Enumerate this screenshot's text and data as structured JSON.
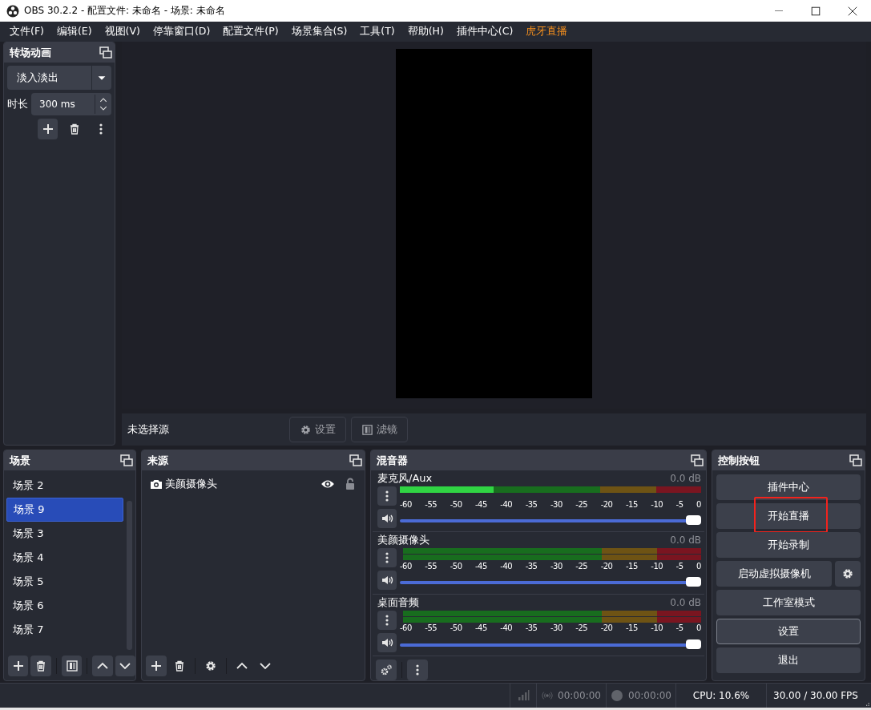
{
  "window": {
    "title": "OBS 30.2.2 - 配置文件: 未命名 - 场景: 未命名"
  },
  "menu": [
    {
      "label": "文件(F)",
      "accent": false
    },
    {
      "label": "编辑(E)",
      "accent": false
    },
    {
      "label": "视图(V)",
      "accent": false
    },
    {
      "label": "停靠窗口(D)",
      "accent": false
    },
    {
      "label": "配置文件(P)",
      "accent": false
    },
    {
      "label": "场景集合(S)",
      "accent": false
    },
    {
      "label": "工具(T)",
      "accent": false
    },
    {
      "label": "帮助(H)",
      "accent": false
    },
    {
      "label": "插件中心(C)",
      "accent": false
    },
    {
      "label": "虎牙直播",
      "accent": true
    }
  ],
  "transitions": {
    "title": "转场动画",
    "selected_transition": "淡入淡出",
    "duration_label": "时长",
    "duration": "300 ms"
  },
  "preview": {
    "source_status": "未选择源",
    "buttons": [
      {
        "label": "设置",
        "kind": "properties",
        "disabled": true
      },
      {
        "label": "滤镜",
        "kind": "filters",
        "disabled": true
      }
    ]
  },
  "scenes": {
    "title": "场景",
    "items": [
      {
        "label": "场景 2",
        "selected": false
      },
      {
        "label": "场景 9",
        "selected": true
      },
      {
        "label": "场景 3",
        "selected": false
      },
      {
        "label": "场景 4",
        "selected": false
      },
      {
        "label": "场景 5",
        "selected": false
      },
      {
        "label": "场景 6",
        "selected": false
      },
      {
        "label": "场景 7",
        "selected": false
      }
    ]
  },
  "sources": {
    "title": "来源",
    "items": [
      {
        "label": "美颜摄像头",
        "kind": "camera",
        "visible": true,
        "locked": false
      }
    ]
  },
  "mixer": {
    "title": "混音器",
    "channels": [
      {
        "name": "麦克风/Aux",
        "reading": "0.0 dB",
        "meter": {
          "kind": "mono",
          "level": 0.31
        },
        "scale": [
          "-60",
          "-55",
          "-50",
          "-45",
          "-40",
          "-35",
          "-30",
          "-25",
          "-20",
          "-15",
          "-10",
          "-5",
          "0"
        ],
        "volume": {
          "level": 1
        }
      },
      {
        "name": "美颜摄像头",
        "reading": "0.0 dB",
        "meter": {
          "kind": "stereo",
          "level": 0
        },
        "scale": [
          "-60",
          "-55",
          "-50",
          "-45",
          "-40",
          "-35",
          "-30",
          "-25",
          "-20",
          "-15",
          "-10",
          "-5",
          "0"
        ],
        "volume": {
          "level": 1
        }
      },
      {
        "name": "桌面音频",
        "reading": "0.0 dB",
        "meter": {
          "kind": "stereo",
          "level": 0
        },
        "scale": [
          "-60",
          "-55",
          "-50",
          "-45",
          "-40",
          "-35",
          "-30",
          "-25",
          "-20",
          "-15",
          "-10",
          "-5",
          "0"
        ],
        "volume": {
          "level": 1
        }
      }
    ]
  },
  "controls": {
    "title": "控制按钮",
    "buttons": [
      {
        "label": "插件中心",
        "kind": "plain",
        "highlighted": false,
        "focused": false
      },
      {
        "label": "开始直播",
        "kind": "plain",
        "highlighted": true,
        "focused": false
      },
      {
        "label": "开始录制",
        "kind": "plain",
        "highlighted": false,
        "focused": false
      },
      {
        "label": "启动虚拟摄像机",
        "kind": "with-settings",
        "highlighted": false,
        "focused": false
      },
      {
        "label": "工作室模式",
        "kind": "plain",
        "highlighted": false,
        "focused": false
      },
      {
        "label": "设置",
        "kind": "plain",
        "highlighted": false,
        "focused": true
      },
      {
        "label": "退出",
        "kind": "plain",
        "highlighted": false,
        "focused": false
      }
    ]
  },
  "status_bar": {
    "stream_time": "00:00:00",
    "record_time": "00:00:00",
    "cpu": "CPU: 10.6%",
    "fps": "30.00 / 30.00 FPS"
  }
}
